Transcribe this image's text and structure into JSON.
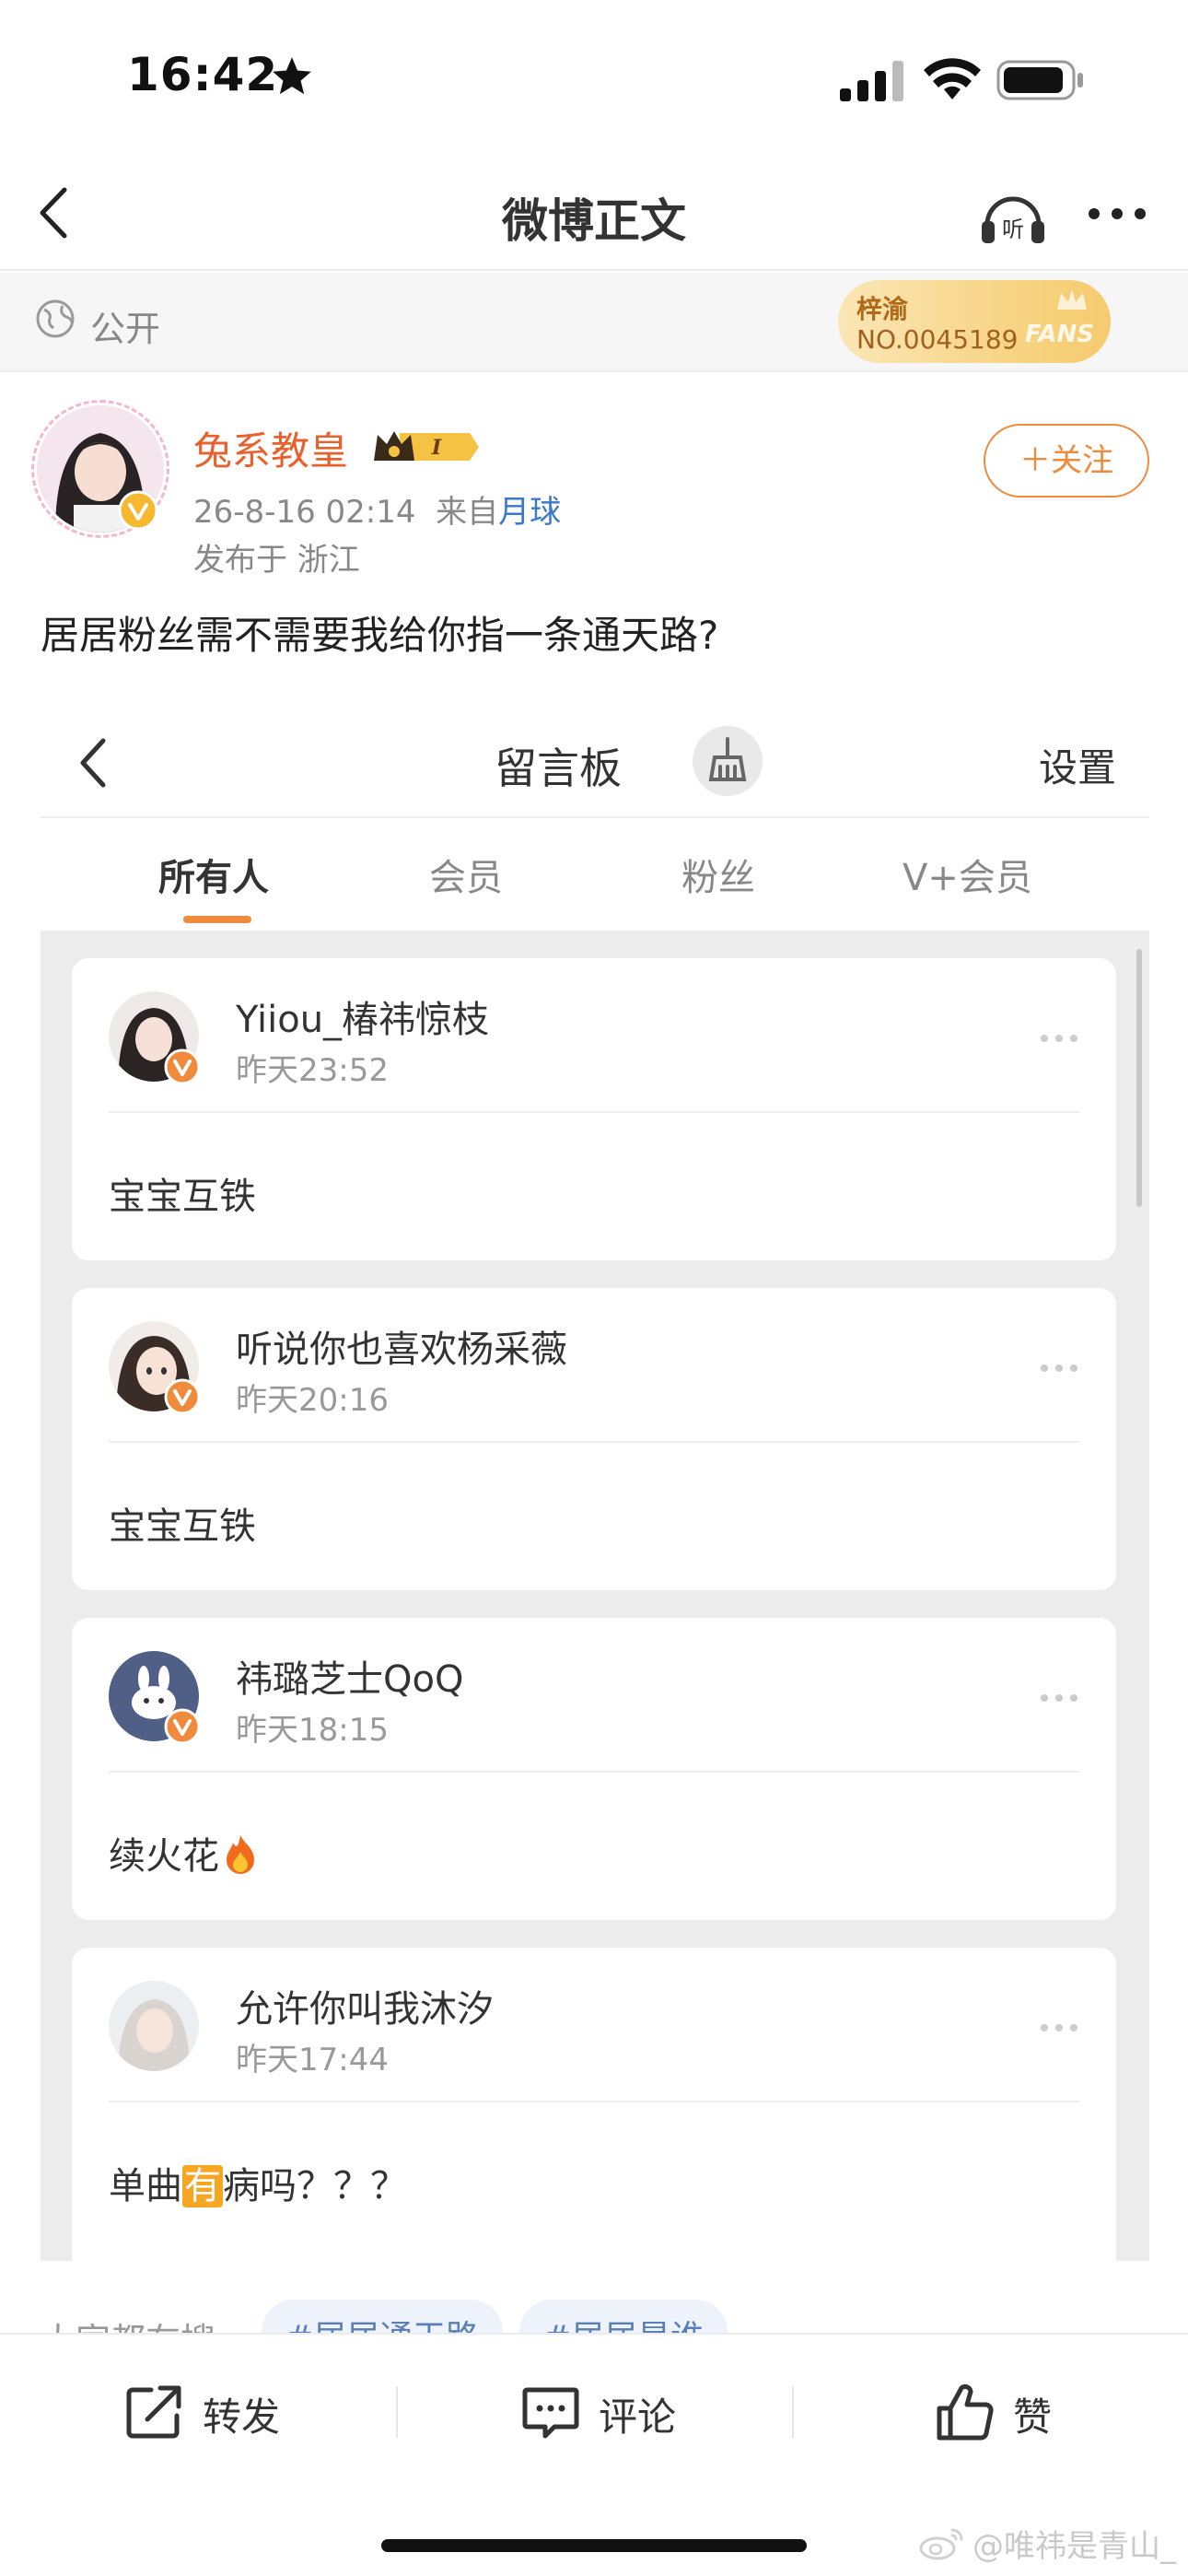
{
  "status_bar": {
    "time": "16:42"
  },
  "nav": {
    "title": "微博正文"
  },
  "visibility": {
    "label": "公开"
  },
  "fans_card": {
    "name": "梓渝",
    "number": "NO.0045189",
    "word": "FANS"
  },
  "author": {
    "name": "兔系教皇",
    "badge_level": "I",
    "time": "26-8-16 02:14",
    "source_prefix": "来自",
    "source": "月球",
    "location": "发布于 浙江",
    "follow_label": "＋关注"
  },
  "post": {
    "text": "居居粉丝需不需要我给你指一条通天路?"
  },
  "board": {
    "title": "留言板",
    "settings_label": "设置",
    "tabs": [
      "所有人",
      "会员",
      "粉丝",
      "V+会员"
    ],
    "messages": [
      {
        "name": "Yiiou_椿祎惊枝",
        "time": "昨天23:52",
        "text": "宝宝互铁"
      },
      {
        "name": "听说你也喜欢杨采薇",
        "time": "昨天20:16",
        "text": "宝宝互铁"
      },
      {
        "name": "祎璐芝士QoQ",
        "time": "昨天18:15",
        "text": "续火花"
      },
      {
        "name": "允许你叫我沐汐",
        "time": "昨天17:44",
        "text_before": "单曲",
        "text_highlight": "有",
        "text_after": "病吗？？？"
      }
    ]
  },
  "topics": {
    "label": "大家都在搜",
    "chips": [
      "#居居通天路",
      "#居居是谁"
    ]
  },
  "actions": {
    "repost": "转发",
    "comment": "评论",
    "like": "赞"
  },
  "watermark": "@唯祎是青山_",
  "colors": {
    "accent": "#f08a3c",
    "name_orange": "#e8602c",
    "link_blue": "#3b78c8"
  }
}
